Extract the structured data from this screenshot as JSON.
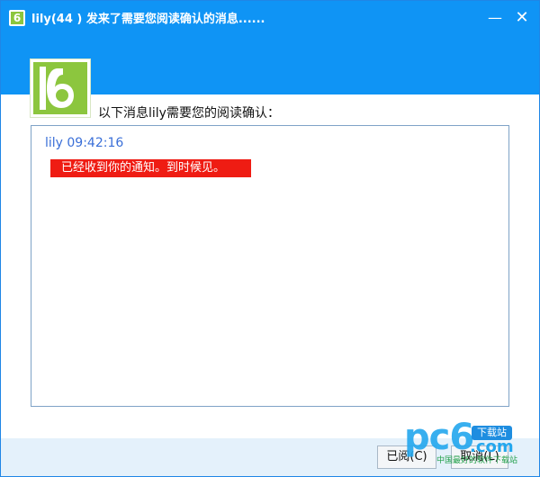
{
  "window": {
    "title": "lily(44 ) 发来了需要您阅读确认的消息......",
    "minimize_glyph": "—",
    "close_glyph": "✕"
  },
  "brand": {
    "title_icon_glyph": "6",
    "logo_name": "pc6-logo"
  },
  "prompt": "以下消息lily需要您的阅读确认：",
  "message": {
    "sender": "lily",
    "time": "09:42:16",
    "header": "lily 09:42:16",
    "text": "已经收到你的通知。到时候见。"
  },
  "buttons": {
    "read": "已阅(C)",
    "cancel": "取消(L)"
  },
  "watermark": {
    "main": "pc6",
    "badge": "下载站",
    "domain": ".com",
    "sub": "中国最好的软件下载站"
  },
  "colors": {
    "titlebar": "#0f94f5",
    "logo_green": "#8cc63e",
    "message_red": "#ef1c13",
    "sender_blue": "#3a6fd8",
    "footer": "#e4f1fb"
  }
}
